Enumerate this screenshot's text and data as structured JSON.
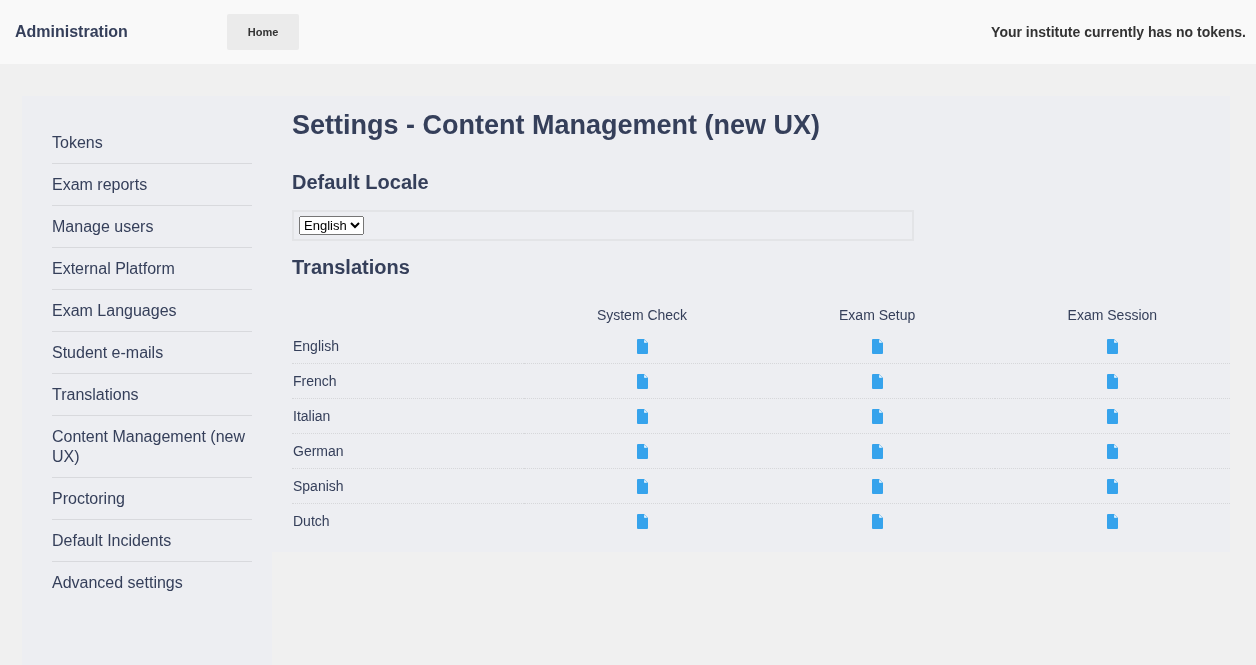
{
  "header": {
    "title": "Administration",
    "home_button": "Home",
    "notice": "Your institute currently has no tokens."
  },
  "sidebar": {
    "items": [
      {
        "label": "Tokens"
      },
      {
        "label": "Exam reports"
      },
      {
        "label": "Manage users"
      },
      {
        "label": "External Platform"
      },
      {
        "label": "Exam Languages"
      },
      {
        "label": "Student e-mails"
      },
      {
        "label": "Translations"
      },
      {
        "label": "Content Management (new UX)"
      },
      {
        "label": "Proctoring"
      },
      {
        "label": "Default Incidents"
      },
      {
        "label": "Advanced settings"
      }
    ]
  },
  "page_title": "Settings - Content Management (new UX)",
  "default_locale": {
    "heading": "Default Locale",
    "value": "English"
  },
  "translations": {
    "heading": "Translations",
    "columns": [
      "System Check",
      "Exam Setup",
      "Exam Session"
    ],
    "rows": [
      {
        "language": "English"
      },
      {
        "language": "French"
      },
      {
        "language": "Italian"
      },
      {
        "language": "German"
      },
      {
        "language": "Spanish"
      },
      {
        "language": "Dutch"
      }
    ]
  }
}
